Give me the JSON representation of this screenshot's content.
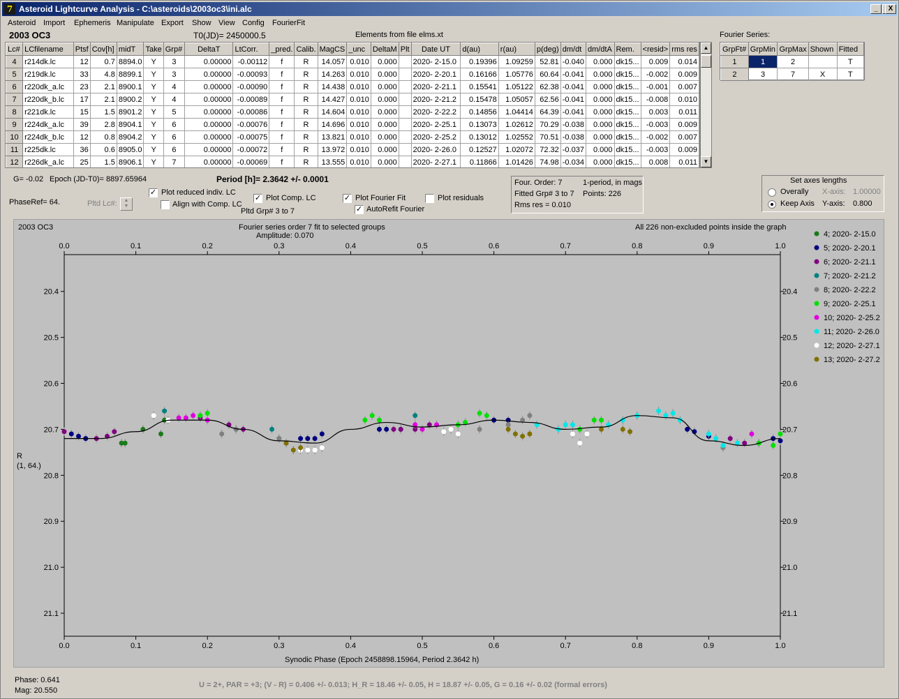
{
  "window": {
    "title": "Asteroid Lightcurve Analysis - C:\\asteroids\\2003oc3\\ini.alc",
    "app_icon": "7z-like-app-icon",
    "controls": [
      "_",
      "□",
      "X"
    ]
  },
  "menu": [
    "Asteroid",
    "Import",
    "Ephemeris",
    "Manipulate",
    "Export",
    "Show",
    "View",
    "Config",
    "FourierFit"
  ],
  "header": {
    "asteroid_name": "2003 OC3",
    "t0": "T0(JD)= 2450000.5",
    "elements": "Elements from file elms.xt",
    "fourier_series_label": "Fourier Series:"
  },
  "lc_table": {
    "columns": [
      "Lc#",
      "LCfilename",
      "Ptsf",
      "Cov[h]",
      "midT",
      "Take",
      "Grp#",
      "DeltaT",
      "LtCorr.",
      "_pred.",
      "Calib.",
      "MagCS",
      "_unc",
      "DeltaM",
      "Plt",
      "Date UT",
      "d(au)",
      "r(au)",
      "p(deg)",
      "dm/dt",
      "dm/dtA",
      "Rem.",
      "<resid>",
      "rms res"
    ],
    "rows": [
      [
        "4",
        "r214dk.lc",
        "12",
        "0.7",
        "8894.0",
        "Y",
        "3",
        "0.00000",
        "-0.00112",
        "f",
        "R",
        "14.057",
        "0.010",
        "0.000",
        "",
        "2020- 2-15.0",
        "0.19396",
        "1.09259",
        "52.81",
        "-0.040",
        "0.000",
        "dk15...",
        "0.009",
        "0.014"
      ],
      [
        "5",
        "r219dk.lc",
        "33",
        "4.8",
        "8899.1",
        "Y",
        "3",
        "0.00000",
        "-0.00093",
        "f",
        "R",
        "14.263",
        "0.010",
        "0.000",
        "",
        "2020- 2-20.1",
        "0.16166",
        "1.05776",
        "60.64",
        "-0.041",
        "0.000",
        "dk15...",
        "-0.002",
        "0.009"
      ],
      [
        "6",
        "r220dk_a.lc",
        "23",
        "2.1",
        "8900.1",
        "Y",
        "4",
        "0.00000",
        "-0.00090",
        "f",
        "R",
        "14.438",
        "0.010",
        "0.000",
        "",
        "2020- 2-21.1",
        "0.15541",
        "1.05122",
        "62.38",
        "-0.041",
        "0.000",
        "dk15...",
        "-0.001",
        "0.007"
      ],
      [
        "7",
        "r220dk_b.lc",
        "17",
        "2.1",
        "8900.2",
        "Y",
        "4",
        "0.00000",
        "-0.00089",
        "f",
        "R",
        "14.427",
        "0.010",
        "0.000",
        "",
        "2020- 2-21.2",
        "0.15478",
        "1.05057",
        "62.56",
        "-0.041",
        "0.000",
        "dk15...",
        "-0.008",
        "0.010"
      ],
      [
        "8",
        "r221dk.lc",
        "15",
        "1.5",
        "8901.2",
        "Y",
        "5",
        "0.00000",
        "-0.00086",
        "f",
        "R",
        "14.604",
        "0.010",
        "0.000",
        "",
        "2020- 2-22.2",
        "0.14856",
        "1.04414",
        "64.39",
        "-0.041",
        "0.000",
        "dk15...",
        "0.003",
        "0.011"
      ],
      [
        "9",
        "r224dk_a.lc",
        "39",
        "2.8",
        "8904.1",
        "Y",
        "6",
        "0.00000",
        "-0.00076",
        "f",
        "R",
        "14.696",
        "0.010",
        "0.000",
        "",
        "2020- 2-25.1",
        "0.13073",
        "1.02612",
        "70.29",
        "-0.038",
        "0.000",
        "dk15...",
        "-0.003",
        "0.009"
      ],
      [
        "10",
        "r224dk_b.lc",
        "12",
        "0.8",
        "8904.2",
        "Y",
        "6",
        "0.00000",
        "-0.00075",
        "f",
        "R",
        "13.821",
        "0.010",
        "0.000",
        "",
        "2020- 2-25.2",
        "0.13012",
        "1.02552",
        "70.51",
        "-0.038",
        "0.000",
        "dk15...",
        "-0.002",
        "0.007"
      ],
      [
        "11",
        "r225dk.lc",
        "36",
        "0.6",
        "8905.0",
        "Y",
        "6",
        "0.00000",
        "-0.00072",
        "f",
        "R",
        "13.972",
        "0.010",
        "0.000",
        "",
        "2020- 2-26.0",
        "0.12527",
        "1.02072",
        "72.32",
        "-0.037",
        "0.000",
        "dk15...",
        "-0.003",
        "0.009"
      ],
      [
        "12",
        "r226dk_a.lc",
        "25",
        "1.5",
        "8906.1",
        "Y",
        "7",
        "0.00000",
        "-0.00069",
        "f",
        "R",
        "13.555",
        "0.010",
        "0.000",
        "",
        "2020- 2-27.1",
        "0.11866",
        "1.01426",
        "74.98",
        "-0.034",
        "0.000",
        "dk15...",
        "0.008",
        "0.011"
      ]
    ]
  },
  "fourier_table": {
    "columns": [
      "GrpFt#",
      "GrpMin",
      "GrpMax",
      "Shown",
      "Fitted"
    ],
    "rows": [
      [
        "1",
        "1",
        "2",
        "",
        "T"
      ],
      [
        "2",
        "3",
        "7",
        "X",
        "T"
      ]
    ]
  },
  "controls": {
    "g_label": "G= -0.02",
    "epoch_label": "Epoch (JD-T0)= 8897.65964",
    "period_label": "Period [h]= 2.3642 +/- 0.0001",
    "phaseref_label": "PhaseRef= 64.",
    "pltd_lc_label": "Pltd Lc#:",
    "plot_reduced": "Plot reduced indiv. LC",
    "align_comp": "Align with Comp. LC",
    "plot_comp": "Plot Comp. LC",
    "pltd_grp": "Pltd Grp#  3   to   7",
    "plot_fourier": "Plot Fourier Fit",
    "autorefit": "AutoRefit Fourier",
    "plot_residuals": "Plot residuals"
  },
  "fit_info": {
    "order": "Four. Order:  7",
    "one_period": "1-period, in mags",
    "fitted": "Fitted Grp# 3 to 7",
    "points": "Points: 226",
    "rms": "Rms res      = 0.010"
  },
  "axes_box": {
    "title": "Set axes lengths",
    "overally": "Overally",
    "keep_axis": "Keep Axis",
    "x_axis_label": "X-axis:",
    "x_axis_value": "1.00000",
    "y_axis_label": "Y-axis:",
    "y_axis_value": "0.800"
  },
  "plot_texts": {
    "corner": "2003 OC3",
    "subtitle": "Fourier series order 7 fit to selected groups",
    "amplitude": "Amplitude: 0.070",
    "note": "All 226 non-excluded points inside the graph",
    "ylabel_line1": "R",
    "ylabel_line2": "(1, 64.)"
  },
  "footer": {
    "phase": "Phase:  0.641",
    "mag": "Mag:    20.550",
    "result": "U = 2+, PAR = +3; (V - R) = 0.406 +/- 0.013; H_R = 18.46 +/- 0.05, H = 18.87 +/- 0.05, G = 0.16 +/- 0.02 (formal errors)"
  },
  "chart_data": {
    "type": "scatter",
    "xlabel": "Synodic Phase (Epoch 2458898.15964, Period 2.3642 h)",
    "xlim": [
      0.0,
      1.0
    ],
    "ylim": [
      20.32,
      21.15
    ],
    "y_inverted": true,
    "x_ticks": [
      "0.0",
      "0.1",
      "0.2",
      "0.3",
      "0.4",
      "0.5",
      "0.6",
      "0.7",
      "0.8",
      "0.9",
      "1.0"
    ],
    "y_ticks": [
      "20.4",
      "20.5",
      "20.6",
      "20.7",
      "20.8",
      "20.9",
      "21.0",
      "21.1"
    ],
    "background": "#c0c0c0",
    "fit_curve_color": "#000000",
    "fourier_fit": {
      "x": [
        0.0,
        0.05,
        0.1,
        0.15,
        0.2,
        0.25,
        0.3,
        0.35,
        0.4,
        0.45,
        0.5,
        0.55,
        0.6,
        0.65,
        0.7,
        0.75,
        0.8,
        0.85,
        0.9,
        0.95,
        1.0
      ],
      "y": [
        20.72,
        20.72,
        20.705,
        20.68,
        20.68,
        20.7,
        20.725,
        20.73,
        20.7,
        20.685,
        20.695,
        20.69,
        20.68,
        20.685,
        20.7,
        20.695,
        20.67,
        20.675,
        20.725,
        20.735,
        20.72
      ]
    },
    "series": [
      {
        "name": "4; 2020- 2-15.0",
        "color": "#1a7a1a",
        "x": [
          0.08,
          0.085,
          0.11,
          0.135,
          0.14
        ],
        "y": [
          20.73,
          20.73,
          20.7,
          20.71,
          20.68
        ]
      },
      {
        "name": "5; 2020- 2-20.1",
        "color": "#000080",
        "x": [
          0.01,
          0.02,
          0.03,
          0.33,
          0.34,
          0.35,
          0.36,
          0.44,
          0.45,
          0.47,
          0.6,
          0.62,
          0.87,
          0.88,
          0.9,
          0.99,
          1.0
        ],
        "y": [
          20.71,
          20.715,
          20.72,
          20.72,
          20.72,
          20.72,
          20.71,
          20.7,
          20.7,
          20.7,
          20.68,
          20.68,
          20.7,
          20.705,
          20.715,
          20.72,
          20.725
        ]
      },
      {
        "name": "6; 2020- 2-21.1",
        "color": "#800080",
        "x": [
          0.0,
          0.045,
          0.06,
          0.07,
          0.19,
          0.23,
          0.25,
          0.46,
          0.47,
          0.49,
          0.51,
          0.93,
          0.95
        ],
        "y": [
          20.705,
          20.72,
          20.715,
          20.705,
          20.675,
          20.69,
          20.7,
          20.7,
          20.7,
          20.7,
          20.69,
          20.72,
          20.73
        ]
      },
      {
        "name": "7; 2020- 2-21.2",
        "color": "#008080",
        "x": [
          0.14,
          0.24,
          0.29,
          0.3,
          0.31,
          0.49,
          0.97
        ],
        "y": [
          20.66,
          20.7,
          20.7,
          20.72,
          20.73,
          20.67,
          20.73
        ]
      },
      {
        "name": "8; 2020- 2-22.2",
        "color": "#808080",
        "x": [
          0.22,
          0.24,
          0.3,
          0.31,
          0.58,
          0.62,
          0.64,
          0.65,
          0.92
        ],
        "y": [
          20.71,
          20.7,
          20.72,
          20.73,
          20.7,
          20.69,
          20.68,
          20.67,
          20.74
        ]
      },
      {
        "name": "9; 2020- 2-25.1",
        "color": "#00e000",
        "x": [
          0.19,
          0.2,
          0.42,
          0.43,
          0.44,
          0.55,
          0.56,
          0.58,
          0.59,
          0.72,
          0.74,
          0.75,
          0.97,
          0.99,
          1.0
        ],
        "y": [
          20.67,
          20.665,
          20.68,
          20.67,
          20.68,
          20.69,
          20.685,
          20.665,
          20.67,
          20.7,
          20.68,
          20.68,
          20.73,
          20.735,
          20.71
        ]
      },
      {
        "name": "10; 2020- 2-25.2",
        "color": "#e000e0",
        "x": [
          0.16,
          0.17,
          0.18,
          0.2,
          0.49,
          0.5,
          0.52,
          0.96
        ],
        "y": [
          20.675,
          20.675,
          20.67,
          20.68,
          20.69,
          20.7,
          20.69,
          20.71
        ]
      },
      {
        "name": "11; 2020- 2-26.0",
        "color": "#00e8e8",
        "x": [
          0.66,
          0.69,
          0.7,
          0.71,
          0.76,
          0.78,
          0.8,
          0.83,
          0.84,
          0.85,
          0.86,
          0.9,
          0.91,
          0.92,
          0.94
        ],
        "y": [
          20.69,
          20.7,
          20.69,
          20.69,
          20.69,
          20.68,
          20.67,
          20.66,
          20.67,
          20.665,
          20.68,
          20.71,
          20.72,
          20.735,
          20.73
        ]
      },
      {
        "name": "12; 2020- 2-27.1",
        "color": "#ffffff",
        "x": [
          0.125,
          0.145,
          0.32,
          0.33,
          0.34,
          0.35,
          0.36,
          0.53,
          0.54,
          0.55,
          0.71,
          0.72,
          0.73
        ],
        "y": [
          20.67,
          20.68,
          20.745,
          20.745,
          20.745,
          20.745,
          20.74,
          20.705,
          20.7,
          20.71,
          20.71,
          20.73,
          20.71
        ]
      },
      {
        "name": "13; 2020- 2-27.2",
        "color": "#807000",
        "x": [
          0.31,
          0.32,
          0.33,
          0.62,
          0.63,
          0.64,
          0.65,
          0.75,
          0.78,
          0.79
        ],
        "y": [
          20.73,
          20.745,
          20.74,
          20.7,
          20.71,
          20.715,
          20.71,
          20.7,
          20.7,
          20.705
        ]
      }
    ]
  }
}
